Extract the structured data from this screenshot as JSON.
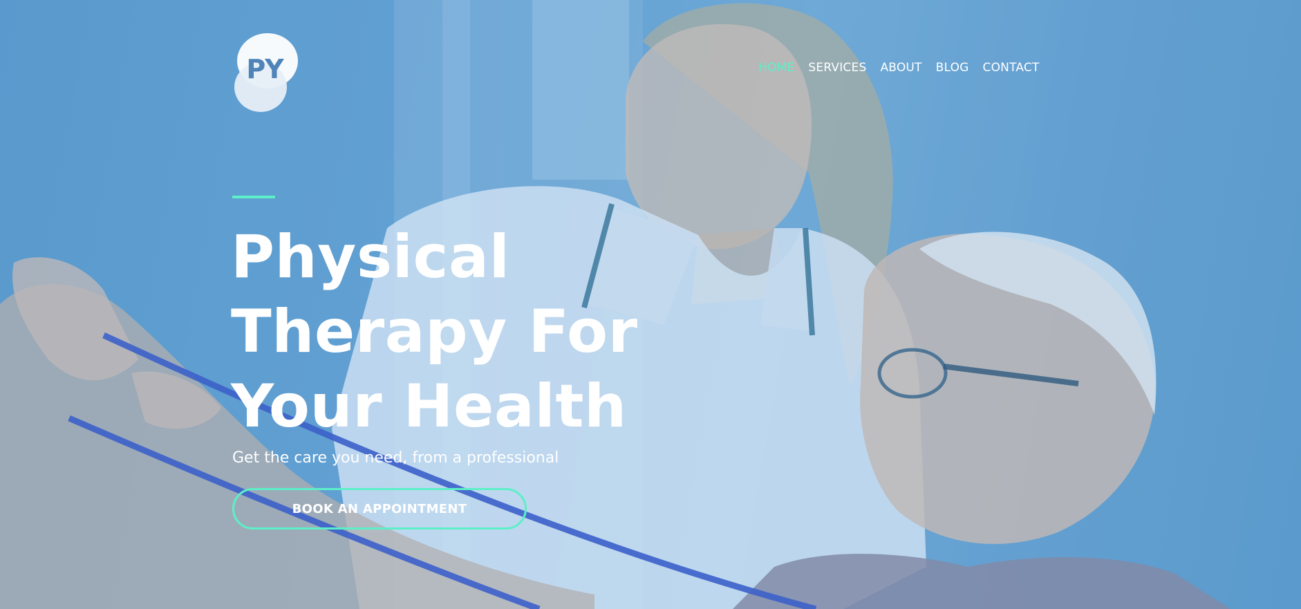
{
  "brand": {
    "logo_text": "PY",
    "logo_icon": "py-logo-icon"
  },
  "nav": {
    "items": [
      {
        "label": "HOME",
        "active": true
      },
      {
        "label": "SERVICES",
        "active": false
      },
      {
        "label": "ABOUT",
        "active": false
      },
      {
        "label": "BLOG",
        "active": false
      },
      {
        "label": "CONTACT",
        "active": false
      }
    ]
  },
  "hero": {
    "title_lines": [
      "Physical",
      "Therapy For",
      "Your Health"
    ],
    "subtitle": "Get the care you need, from a professional",
    "cta_label": "BOOK AN APPOINTMENT",
    "image": "physical-therapist-with-elderly-patient-photo"
  },
  "colors": {
    "accent": "#5cf0c8",
    "overlay_blue": "#5f9fcf",
    "text": "#ffffff",
    "resistance_band": "#3a57c9"
  }
}
